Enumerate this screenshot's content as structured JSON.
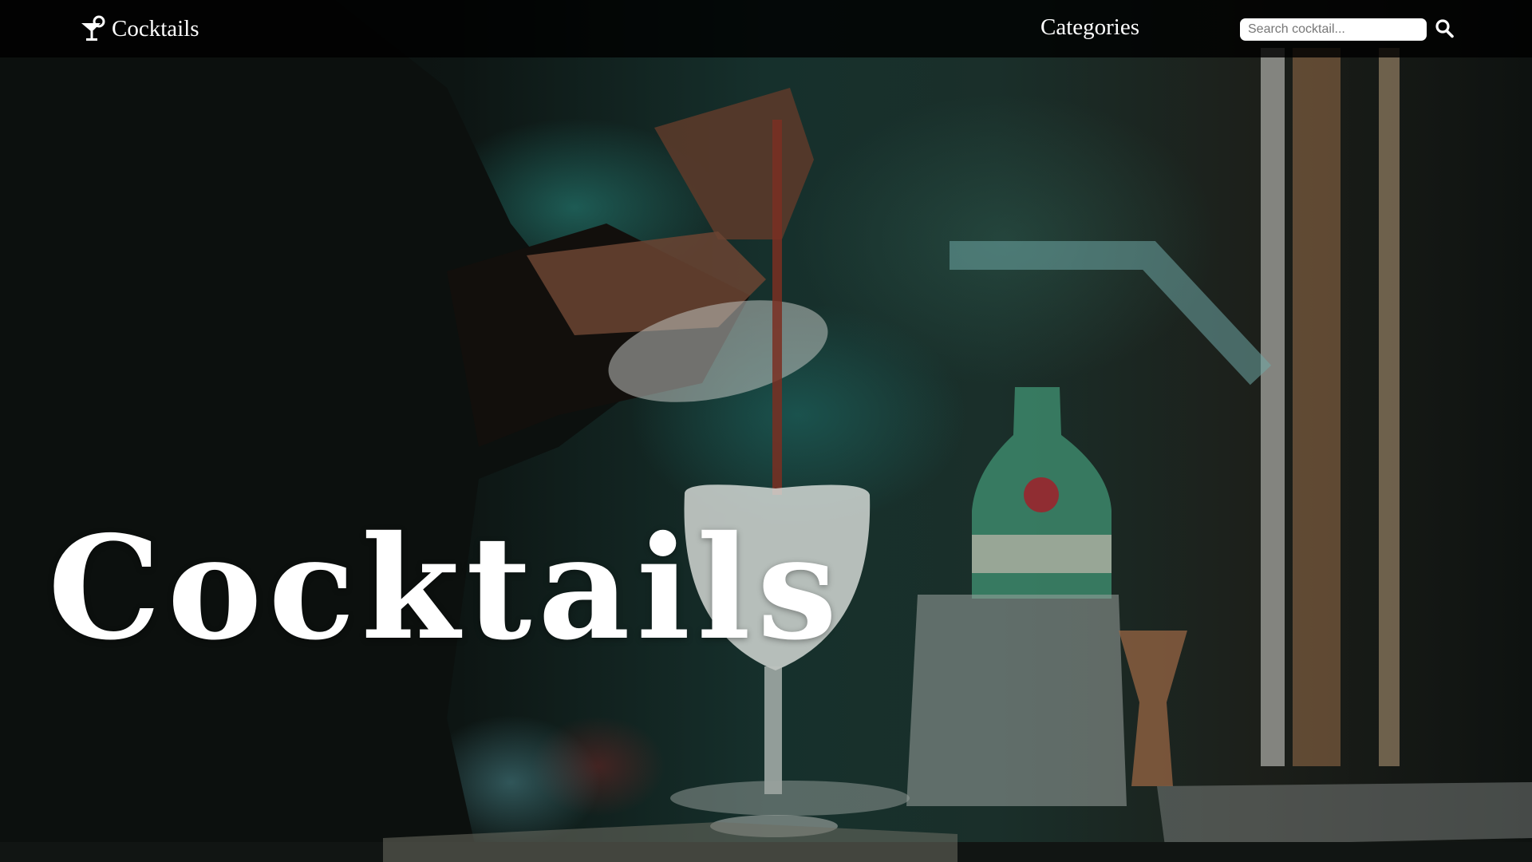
{
  "navbar": {
    "brand_label": "Cocktails",
    "brand_icon": "cocktail-glass-icon",
    "categories_label": "Categories",
    "search": {
      "placeholder": "Search cocktail...",
      "value": "",
      "button_icon": "search-icon"
    }
  },
  "hero": {
    "title": "Cocktails"
  },
  "colors": {
    "navbar_bg": "#000000",
    "text": "#ffffff",
    "search_bg": "#ffffff"
  }
}
